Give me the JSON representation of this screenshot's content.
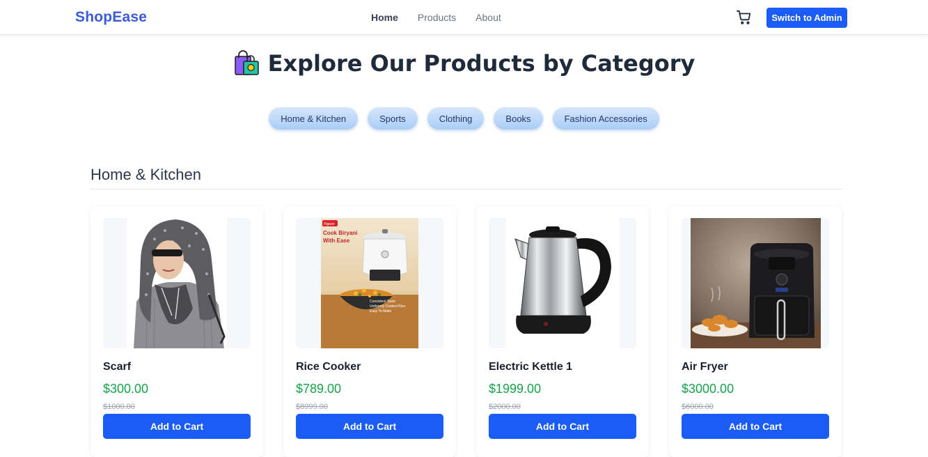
{
  "navbar": {
    "brand": "ShopEase",
    "links": [
      {
        "label": "Home",
        "active": true
      },
      {
        "label": "Products",
        "active": false
      },
      {
        "label": "About",
        "active": false
      }
    ],
    "cart_icon": "cart-icon",
    "admin_button": "Switch to Admin"
  },
  "hero": {
    "title": "Explore Our Products by Category",
    "title_icon": "shopping-bags-icon"
  },
  "categories": [
    "Home & Kitchen",
    "Sports",
    "Clothing",
    "Books",
    "Fashion Accessories"
  ],
  "section": {
    "title": "Home & Kitchen",
    "products": [
      {
        "name": "Scarf",
        "price": "$300.00",
        "old_price": "$1000.00",
        "cta": "Add to Cart",
        "image": "scarf-photo"
      },
      {
        "name": "Rice Cooker",
        "price": "$789.00",
        "old_price": "$8999.00",
        "cta": "Add to Cart",
        "image": "rice-cooker-photo",
        "image_text": [
          "Pigeon",
          "Cook Biryani",
          "With Ease",
          "Consistent Taste",
          "Uniformly Cooked Rice",
          "Easy To Make"
        ]
      },
      {
        "name": "Electric Kettle 1",
        "price": "$1999.00",
        "old_price": "$2000.00",
        "cta": "Add to Cart",
        "image": "kettle-photo"
      },
      {
        "name": "Air Fryer",
        "price": "$3000.00",
        "old_price": "$6000.00",
        "cta": "Add to Cart",
        "image": "air-fryer-photo"
      }
    ]
  },
  "colors": {
    "brand": "#3b5bdb",
    "primary_button": "#1a5cf5",
    "price": "#16a34a",
    "pill_start": "#d6e6fb",
    "pill_end": "#a9cdf6"
  }
}
